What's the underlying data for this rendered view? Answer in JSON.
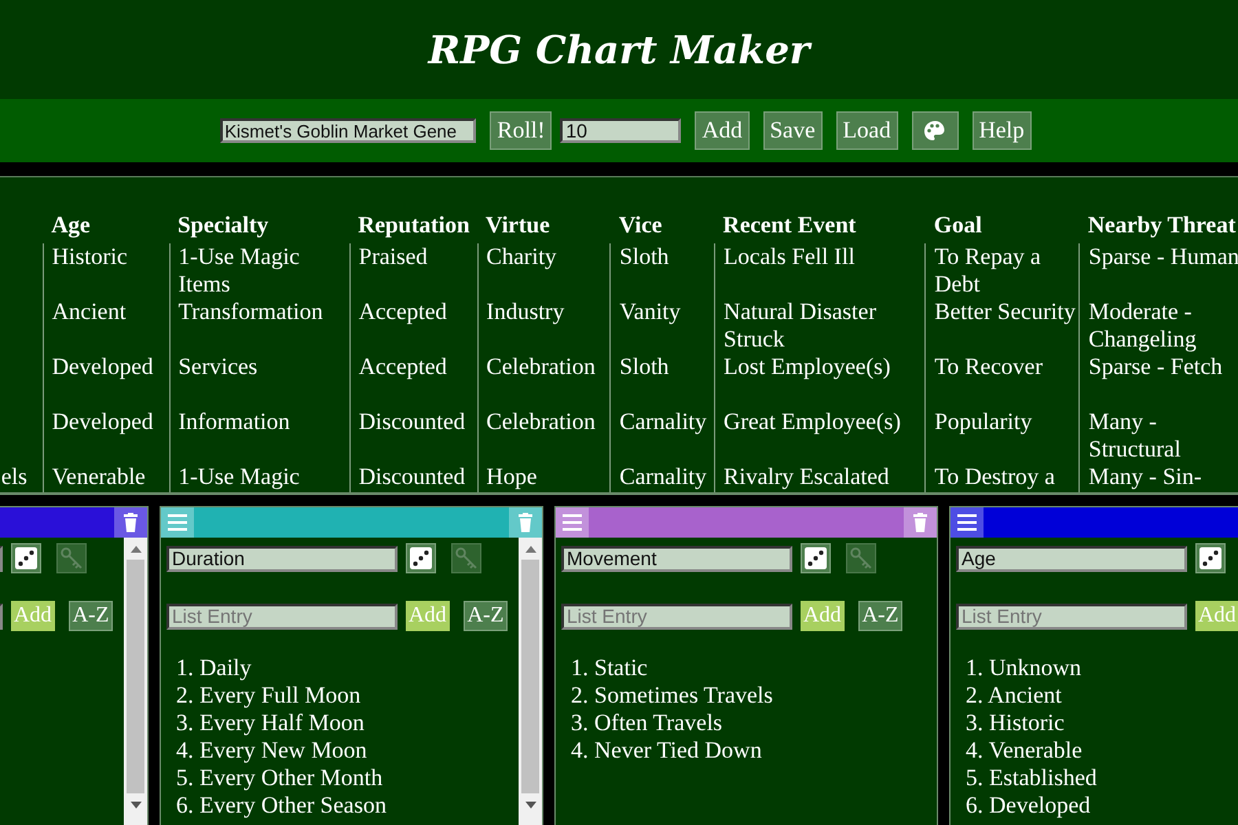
{
  "app_title": "RPG Chart Maker",
  "toolbar": {
    "chart_name": "Kismet's Goblin Market Gene",
    "roll_button": "Roll!",
    "roll_count": "10",
    "buttons": [
      {
        "kind": "text",
        "label": "Add"
      },
      {
        "kind": "text",
        "label": "Save"
      },
      {
        "kind": "text",
        "label": "Load"
      },
      {
        "kind": "palette"
      },
      {
        "kind": "text",
        "label": "Help"
      }
    ]
  },
  "results_table": {
    "columns": [
      {},
      {
        "heading": "Age"
      },
      {
        "heading": "Specialty"
      },
      {
        "heading": "Reputation"
      },
      {
        "heading": "Virtue"
      },
      {
        "heading": "Vice"
      },
      {
        "heading": "Recent Event"
      },
      {
        "heading": "Goal"
      },
      {
        "heading": "Nearby Threat"
      }
    ],
    "rows": [
      [
        null,
        "Historic",
        "1-Use Magic Items",
        "Praised",
        "Charity",
        "Sloth",
        "Locals Fell Ill",
        "To Repay a Debt",
        "Sparse - Human"
      ],
      [
        null,
        "Ancient",
        "Transformation",
        "Accepted",
        "Industry",
        "Vanity",
        "Natural Disaster Struck",
        "Better Security",
        "Moderate - Changeling"
      ],
      [
        null,
        "Developed",
        "Services",
        "Accepted",
        "Celebration",
        "Sloth",
        "Lost Employee(s)",
        "To Recover",
        "Sparse - Fetch"
      ],
      [
        null,
        "Developed",
        "Information",
        "Discounted",
        "Celebration",
        "Carnality",
        "Great Employee(s)",
        "Popularity",
        "Many - Structural"
      ],
      [
        "els",
        "Venerable",
        "1-Use Magic",
        "Discounted",
        "Hope",
        "Carnality",
        "Rivalry Escalated",
        "To Destroy a",
        "Many - Sin-"
      ]
    ]
  },
  "list_panels": [
    {
      "color": "#2a10d8",
      "scrollbar": true,
      "add_button": "Add",
      "sort_button": "A-Z"
    },
    {
      "color": "#20b2b2",
      "scrollbar": true,
      "title": "Duration",
      "placeholder": "List Entry",
      "add_button": "Add",
      "sort_button": "A-Z",
      "items": [
        "1. Daily",
        "2. Every Full Moon",
        "3. Every Half Moon",
        "4. Every New Moon",
        "5. Every Other Month",
        "6. Every Other Season"
      ]
    },
    {
      "color": "#a862cc",
      "scrollbar": false,
      "title": "Movement",
      "placeholder": "List Entry",
      "add_button": "Add",
      "sort_button": "A-Z",
      "items": [
        "1. Static",
        "2. Sometimes Travels",
        "3. Often Travels",
        "4. Never Tied Down"
      ]
    },
    {
      "color": "#0000d8",
      "scrollbar": false,
      "title": "Age",
      "placeholder": "List Entry",
      "add_button": "Add",
      "items": [
        "1. Unknown",
        "2. Ancient",
        "3. Historic",
        "4. Venerable",
        "5. Established",
        "6. Developed"
      ]
    }
  ]
}
